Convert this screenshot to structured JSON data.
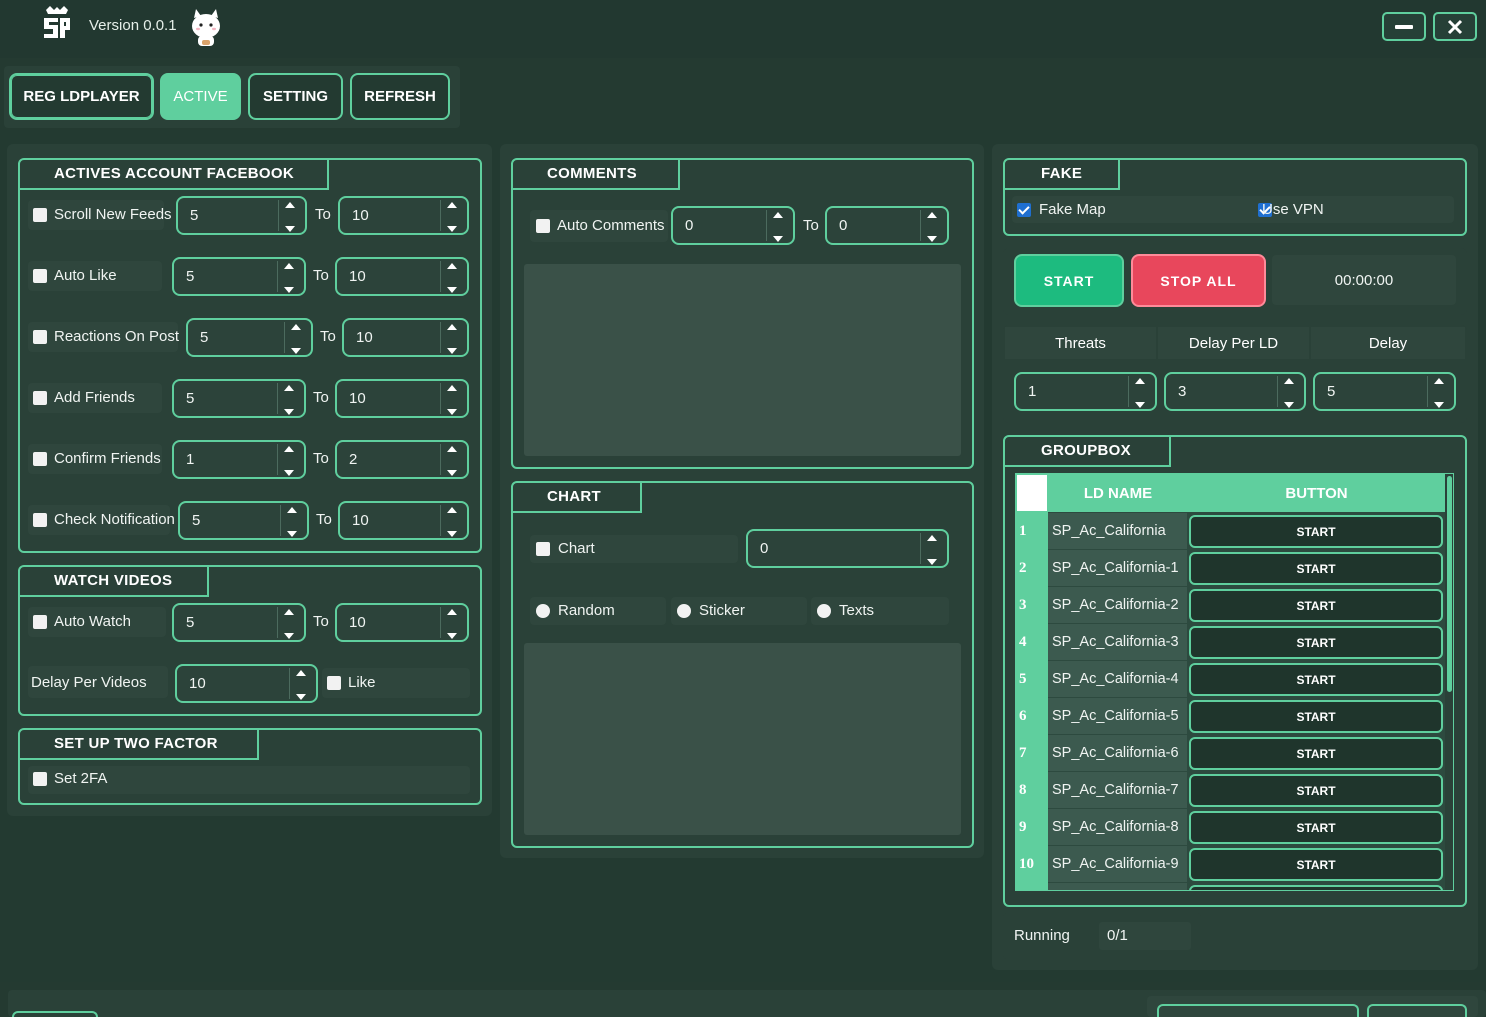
{
  "app": {
    "version": "Version 0.0.1"
  },
  "window": {
    "minimize_icon": "minus-icon",
    "close_icon": "close-icon"
  },
  "tabs": [
    "REG LDPLAYER",
    "ACTIVE",
    "SETTING",
    "REFRESH"
  ],
  "actives": {
    "title": "ACTIVES ACCOUNT FACEBOOK",
    "to_label": "To",
    "rows": [
      {
        "label": "Scroll New Feeds",
        "from": "5",
        "to": "10"
      },
      {
        "label": "Auto Like",
        "from": "5",
        "to": "10"
      },
      {
        "label": "Reactions On Post",
        "from": "5",
        "to": "10"
      },
      {
        "label": "Add Friends",
        "from": "5",
        "to": "10"
      },
      {
        "label": "Confirm Friends",
        "from": "1",
        "to": "2"
      },
      {
        "label": "Check Notification",
        "from": "5",
        "to": "10"
      }
    ]
  },
  "watch": {
    "title": "WATCH VIDEOS",
    "auto_watch": {
      "label": "Auto Watch",
      "from": "5",
      "to": "10"
    },
    "delay_label": "Delay Per Videos",
    "delay_value": "10",
    "like_label": "Like"
  },
  "twofactor": {
    "title": "SET UP TWO FACTOR",
    "label": "Set 2FA"
  },
  "comments": {
    "title": "COMMENTS",
    "label": "Auto Comments",
    "from": "0",
    "to_label": "To",
    "to": "0"
  },
  "chart": {
    "title": "CHART",
    "label": "Chart",
    "value": "0",
    "radios": [
      "Random",
      "Sticker",
      "Texts"
    ]
  },
  "fake": {
    "title": "FAKE",
    "fake_map": "Fake Map",
    "use_vpn": "Use VPN"
  },
  "controls": {
    "start": "START",
    "stop_all": "STOP ALL",
    "timer": "00:00:00"
  },
  "settings": {
    "headers": [
      "Threats",
      "Delay Per LD",
      "Delay"
    ],
    "values": [
      "1",
      "3",
      "5"
    ]
  },
  "groupbox": {
    "title": "GROUPBOX",
    "col_name": "LD NAME",
    "col_button": "BUTTON",
    "rows": [
      {
        "num": "1",
        "name": "SP_Ac_California",
        "button": "START"
      },
      {
        "num": "2",
        "name": "SP_Ac_California-1",
        "button": "START"
      },
      {
        "num": "3",
        "name": "SP_Ac_California-2",
        "button": "START"
      },
      {
        "num": "4",
        "name": "SP_Ac_California-3",
        "button": "START"
      },
      {
        "num": "5",
        "name": "SP_Ac_California-4",
        "button": "START"
      },
      {
        "num": "6",
        "name": "SP_Ac_California-5",
        "button": "START"
      },
      {
        "num": "7",
        "name": "SP_Ac_California-6",
        "button": "START"
      },
      {
        "num": "8",
        "name": "SP_Ac_California-7",
        "button": "START"
      },
      {
        "num": "9",
        "name": "SP_Ac_California-8",
        "button": "START"
      },
      {
        "num": "10",
        "name": "SP_Ac_California-9",
        "button": "START"
      }
    ]
  },
  "status": {
    "label": "Running",
    "value": "0/1"
  },
  "colors": {
    "accent": "#5fcf9e",
    "background": "#243a31",
    "start": "#1dbb7f",
    "stop": "#e8475c"
  }
}
